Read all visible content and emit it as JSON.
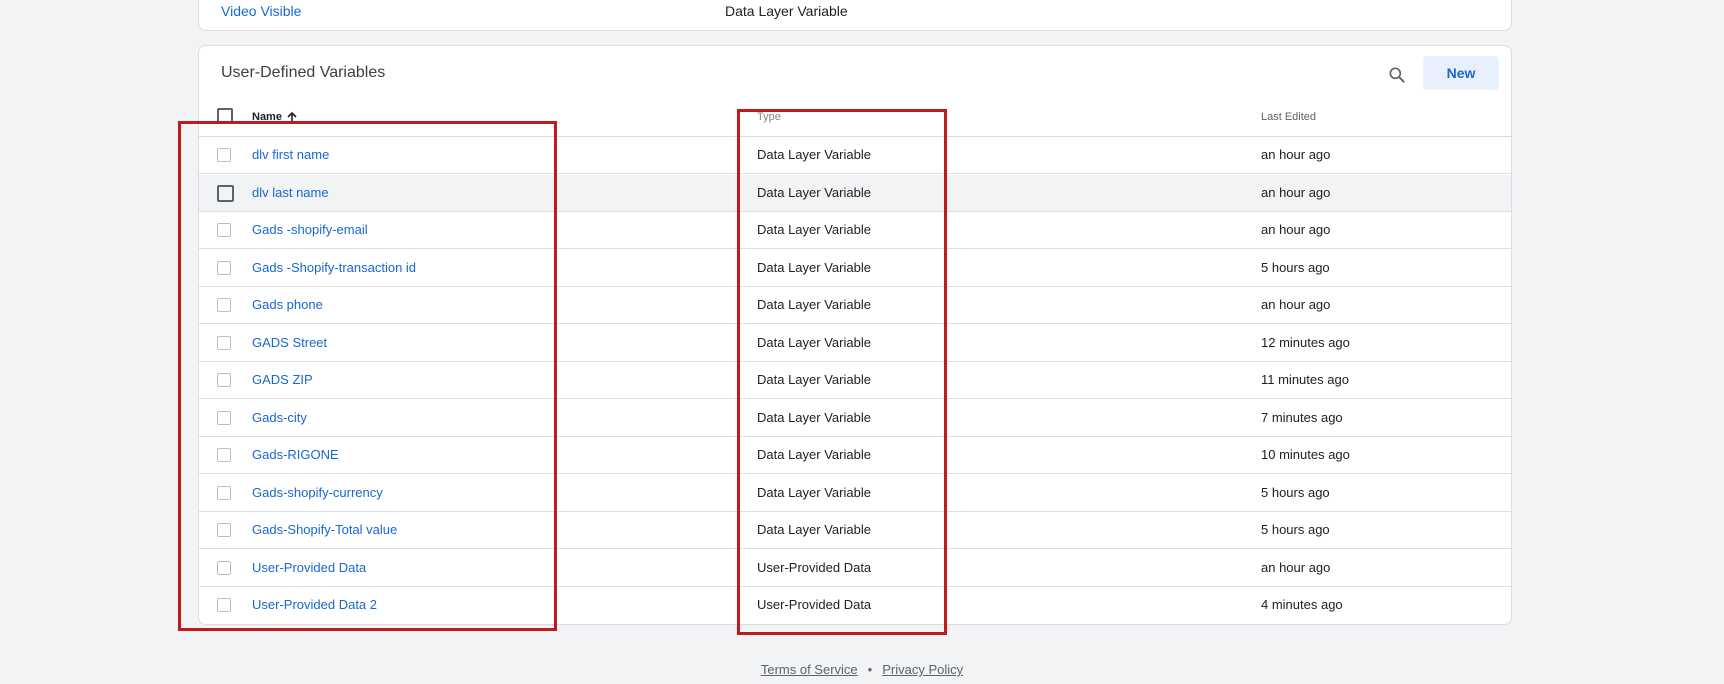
{
  "top_row": {
    "name": "Video Visible",
    "type": "Data Layer Variable"
  },
  "panel": {
    "title": "User-Defined Variables",
    "new_label": "New",
    "search_icon": "search-icon",
    "columns": {
      "name": "Name",
      "type": "Type",
      "last_edited": "Last Edited"
    },
    "sort_icon": "arrow-up-icon",
    "rows": [
      {
        "name": "dlv first name",
        "type": "Data Layer Variable",
        "last_edited": "an hour ago"
      },
      {
        "name": "dlv last name",
        "type": "Data Layer Variable",
        "last_edited": "an hour ago"
      },
      {
        "name": "Gads -shopify-email",
        "type": "Data Layer Variable",
        "last_edited": "an hour ago"
      },
      {
        "name": "Gads -Shopify-transaction id",
        "type": "Data Layer Variable",
        "last_edited": "5 hours ago"
      },
      {
        "name": "Gads phone",
        "type": "Data Layer Variable",
        "last_edited": "an hour ago"
      },
      {
        "name": "GADS Street",
        "type": "Data Layer Variable",
        "last_edited": "12 minutes ago"
      },
      {
        "name": "GADS ZIP",
        "type": "Data Layer Variable",
        "last_edited": "11 minutes ago"
      },
      {
        "name": "Gads-city",
        "type": "Data Layer Variable",
        "last_edited": "7 minutes ago"
      },
      {
        "name": "Gads-RIGONE",
        "type": "Data Layer Variable",
        "last_edited": "10 minutes ago"
      },
      {
        "name": "Gads-shopify-currency",
        "type": "Data Layer Variable",
        "last_edited": "5 hours ago"
      },
      {
        "name": "Gads-Shopify-Total value",
        "type": "Data Layer Variable",
        "last_edited": "5 hours ago"
      },
      {
        "name": "User-Provided Data",
        "type": "User-Provided Data",
        "last_edited": "an hour ago"
      },
      {
        "name": "User-Provided Data 2",
        "type": "User-Provided Data",
        "last_edited": "4 minutes ago"
      }
    ]
  },
  "footer": {
    "terms": "Terms of Service",
    "separator": "•",
    "privacy": "Privacy Policy"
  },
  "colors": {
    "link": "#1967d2",
    "annotation": "#c11a1a",
    "background": "#f1f3f4"
  }
}
